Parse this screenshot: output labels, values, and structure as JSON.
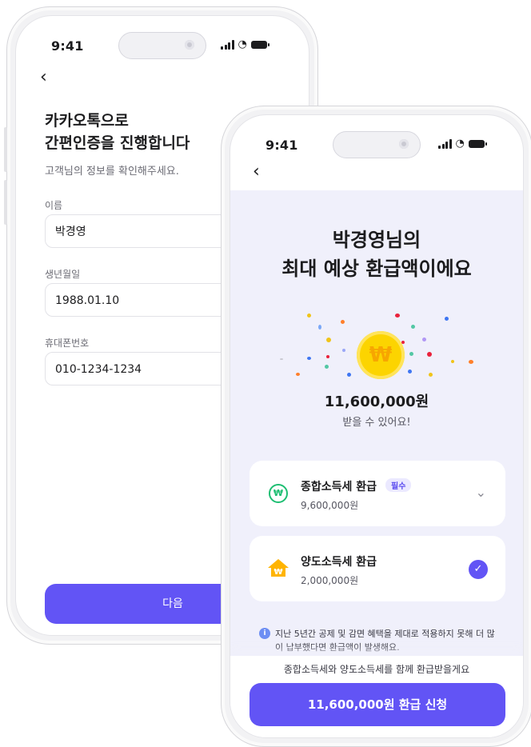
{
  "back_phone": {
    "time": "9:41",
    "heading_line1": "카카오톡으로",
    "heading_line2": "간편인증을 진행합니다",
    "subtitle": "고객님의 정보를 확인해주세요.",
    "fields": [
      {
        "label": "이름",
        "value": "박경영"
      },
      {
        "label": "생년월일",
        "value": "1988.01.10"
      },
      {
        "label": "휴대폰번호",
        "value": "010-1234-1234"
      }
    ],
    "next_label": "다음"
  },
  "front_phone": {
    "time": "9:41",
    "title_line1": "박경영님의",
    "title_line2": "최대 예상 환급액이에요",
    "coin_symbol": "₩",
    "amount": "11,600,000원",
    "amount_sub": "받을 수 있어요!",
    "items": [
      {
        "title": "종합소득세 환급",
        "badge": "필수",
        "amount": "9,600,000원",
        "icon": "refund-won-icon",
        "control": "chevron-down"
      },
      {
        "title": "양도소득세 환급",
        "amount": "2,000,000원",
        "icon": "house-won-icon",
        "control": "check-selected"
      }
    ],
    "info_text": "지난 5년간 공제 및 감면 혜택을 제대로 적용하지 못해 더 많이 납부했다면 환급액이 발생해요.",
    "sheet_text": "종합소득세와 양도소득세를 함께 환급받을게요",
    "apply_label": "11,600,000원 환급 신청"
  },
  "colors": {
    "accent": "#6254f5",
    "result_background": "#f0f0fb",
    "coin": "#fcd400",
    "refund_green": "#1ebe72",
    "house_orange": "#ffb400"
  }
}
